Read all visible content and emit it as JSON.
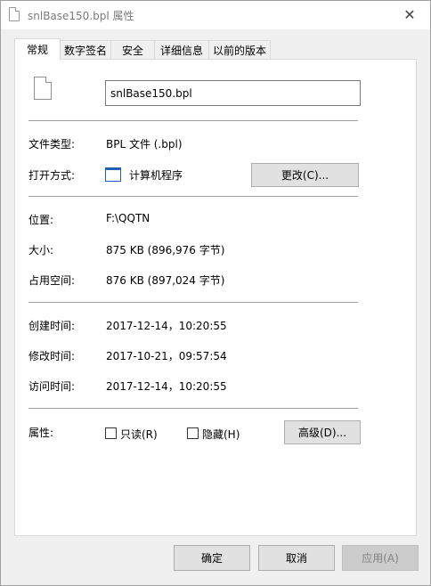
{
  "window": {
    "title": "snlBase150.bpl 属性",
    "close_glyph": "✕"
  },
  "tabs": [
    {
      "label": "常规"
    },
    {
      "label": "数字签名"
    },
    {
      "label": "安全"
    },
    {
      "label": "详细信息"
    },
    {
      "label": "以前的版本"
    }
  ],
  "general": {
    "filename": "snlBase150.bpl",
    "file_type_label": "文件类型:",
    "file_type_value": "BPL 文件 (.bpl)",
    "open_with_label": "打开方式:",
    "open_with_value": "计算机程序",
    "change_button": "更改(C)...",
    "location_label": "位置:",
    "location_value": "F:\\QQTN",
    "size_label": "大小:",
    "size_value": "875 KB (896,976 字节)",
    "size_on_disk_label": "占用空间:",
    "size_on_disk_value": "876 KB (897,024 字节)",
    "created_label": "创建时间:",
    "created_value": "2017-12-14，10:20:55",
    "modified_label": "修改时间:",
    "modified_value": "2017-10-21，09:57:54",
    "accessed_label": "访问时间:",
    "accessed_value": "2017-12-14，10:20:55",
    "attributes_label": "属性:",
    "readonly_label": "只读(R)",
    "hidden_label": "隐藏(H)",
    "advanced_button": "高级(D)..."
  },
  "footer": {
    "ok": "确定",
    "cancel": "取消",
    "apply": "应用(A)"
  }
}
